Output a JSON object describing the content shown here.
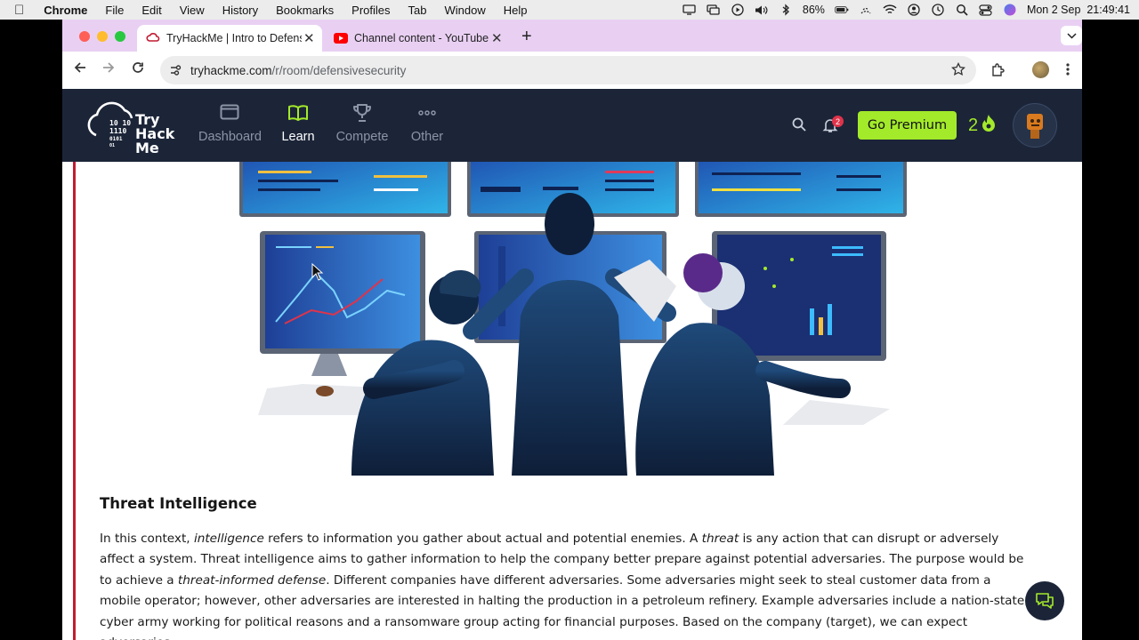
{
  "menubar": {
    "app": "Chrome",
    "items": [
      "File",
      "Edit",
      "View",
      "History",
      "Bookmarks",
      "Profiles",
      "Tab",
      "Window",
      "Help"
    ],
    "battery": "86%",
    "datetime": "Mon 2 Sep  21:49:41"
  },
  "browser": {
    "tabs": [
      {
        "title": "TryHackMe | Intro to Defensiv",
        "icon": "tryhackme-favicon"
      },
      {
        "title": "Channel content - YouTube St",
        "icon": "youtube-favicon"
      }
    ],
    "url_domain": "tryhackme.com",
    "url_path": "/r/room/defensivesecurity"
  },
  "site": {
    "logo_lines": [
      "Try",
      "Hack",
      "Me"
    ],
    "logo_binary": [
      "10  10",
      "1110",
      "0101",
      "01"
    ],
    "nav": [
      {
        "label": "Dashboard",
        "icon": "monitor-icon"
      },
      {
        "label": "Learn",
        "icon": "book-icon"
      },
      {
        "label": "Compete",
        "icon": "trophy-icon"
      },
      {
        "label": "Other",
        "icon": "more-icon"
      }
    ],
    "notification_count": "2",
    "premium_label": "Go Premium",
    "streak": "2",
    "colors": {
      "navbar": "#1c2538",
      "accent_green": "#a3ea2a",
      "active_nav": "#ffffff",
      "inactive_nav": "#8b95a6",
      "section_accent": "#c11b32"
    }
  },
  "article": {
    "heading": "Threat Intelligence",
    "p_1": "In this context, ",
    "p_2": "intelligence",
    "p_3": " refers to information you gather about actual and potential enemies. A ",
    "p_4": "threat",
    "p_5": " is any action that can disrupt or adversely affect a system. Threat intelligence aims to gather information to help the company better prepare against potential adversaries. The purpose would be to achieve a ",
    "p_6": "threat-informed defense",
    "p_7": ". Different companies have different adversaries. Some adversaries might seek to steal customer data from a mobile operator; however, other adversaries are interested in halting the production in a petroleum refinery. Example adversaries include a nation-state cyber army working for political reasons and a ransomware group acting for financial purposes. Based on the company (target), we can expect adversaries."
  }
}
